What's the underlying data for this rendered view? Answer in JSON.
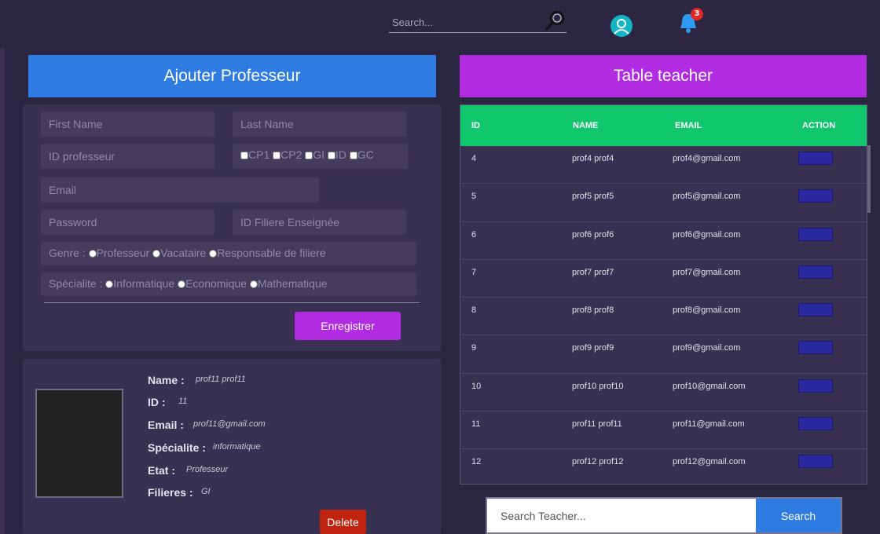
{
  "topbar": {
    "search_placeholder": "Search...",
    "notification_count": "3",
    "avatar_color": "#13b5c4",
    "bell_color": "#2e9af0"
  },
  "add_form": {
    "title": "Ajouter Professeur",
    "first_name_placeholder": "First Name",
    "last_name_placeholder": "Last Name",
    "id_placeholder": "ID professeur",
    "email_placeholder": "Email",
    "password_placeholder": "Password",
    "filiere_placeholder": "ID Filiere Enseignée",
    "filieres": [
      "CP1",
      "CP2",
      "GI",
      "ID",
      "GC"
    ],
    "genre_label": "Genre :",
    "genre_options": [
      "Professeur",
      "Vacataire",
      "Responsable de filiere"
    ],
    "specialite_label": "Spécialite :",
    "specialite_options": [
      "Informatique",
      "Economique",
      "Mathematique"
    ],
    "save_label": "Enregistrer"
  },
  "detail": {
    "name_label": "Name :",
    "name_value": "prof11 prof11",
    "id_label": "ID :",
    "id_value": "11",
    "email_label": "Email :",
    "email_value": "prof11@gmail.com",
    "specialite_label": "Spécialite :",
    "specialite_value": "informatique",
    "etat_label": "Etat :",
    "etat_value": "Professeur",
    "filieres_label": "Filieres :",
    "filieres_value": "GI",
    "delete_label": "Delete"
  },
  "table": {
    "title": "Table teacher",
    "headers": {
      "id": "ID",
      "name": "NAME",
      "email": "EMAIL",
      "action": "ACTION"
    },
    "rows": [
      {
        "id": "4",
        "name": "prof4 prof4",
        "email": "prof4@gmail.com"
      },
      {
        "id": "5",
        "name": "prof5 prof5",
        "email": "prof5@gmail.com"
      },
      {
        "id": "6",
        "name": "prof6 prof6",
        "email": "prof6@gmail.com"
      },
      {
        "id": "7",
        "name": "prof7 prof7",
        "email": "prof7@gmail.com"
      },
      {
        "id": "8",
        "name": "prof8 prof8",
        "email": "prof8@gmail.com"
      },
      {
        "id": "9",
        "name": "prof9 prof9",
        "email": "prof9@gmail.com"
      },
      {
        "id": "10",
        "name": "prof10 prof10",
        "email": "prof10@gmail.com"
      },
      {
        "id": "11",
        "name": "prof11 prof11",
        "email": "prof11@gmail.com"
      },
      {
        "id": "12",
        "name": "prof12 prof12",
        "email": "prof12@gmail.com"
      }
    ]
  },
  "teacher_search": {
    "placeholder": "Search Teacher...",
    "button_label": "Search"
  }
}
